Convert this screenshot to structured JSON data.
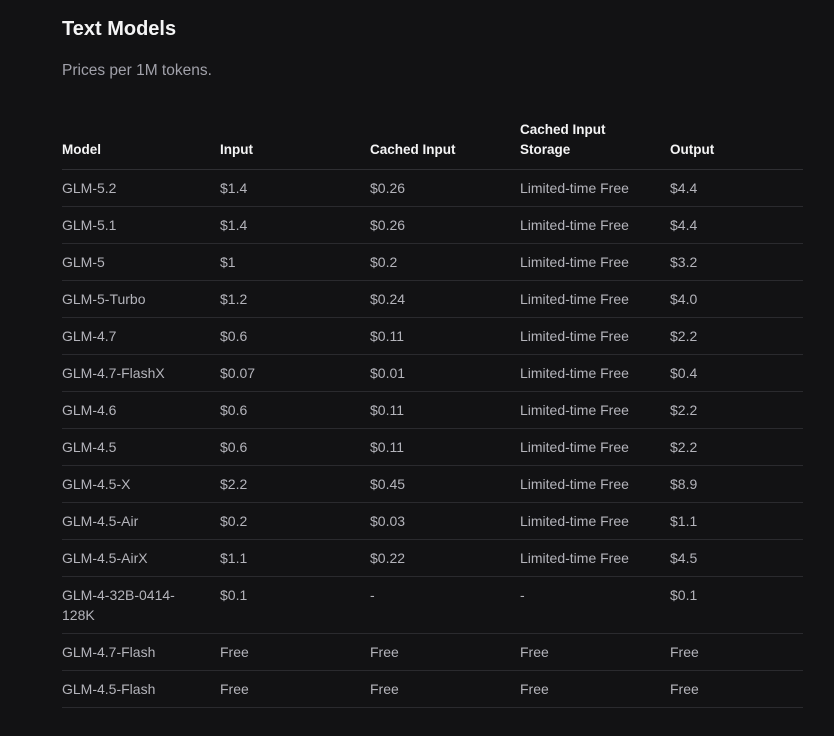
{
  "header": {
    "title": "Text Models",
    "subtitle": "Prices per 1M tokens."
  },
  "table": {
    "columns": [
      "Model",
      "Input",
      "Cached Input",
      "Cached Input\nStorage",
      "Output"
    ],
    "rows": [
      [
        "GLM-5.2",
        "$1.4",
        "$0.26",
        "Limited-time Free",
        "$4.4"
      ],
      [
        "GLM-5.1",
        "$1.4",
        "$0.26",
        "Limited-time Free",
        "$4.4"
      ],
      [
        "GLM-5",
        "$1",
        "$0.2",
        "Limited-time Free",
        "$3.2"
      ],
      [
        "GLM-5-Turbo",
        "$1.2",
        "$0.24",
        "Limited-time Free",
        "$4.0"
      ],
      [
        "GLM-4.7",
        "$0.6",
        "$0.11",
        "Limited-time Free",
        "$2.2"
      ],
      [
        "GLM-4.7-FlashX",
        "$0.07",
        "$0.01",
        "Limited-time Free",
        "$0.4"
      ],
      [
        "GLM-4.6",
        "$0.6",
        "$0.11",
        "Limited-time Free",
        "$2.2"
      ],
      [
        "GLM-4.5",
        "$0.6",
        "$0.11",
        "Limited-time Free",
        "$2.2"
      ],
      [
        "GLM-4.5-X",
        "$2.2",
        "$0.45",
        "Limited-time Free",
        "$8.9"
      ],
      [
        "GLM-4.5-Air",
        "$0.2",
        "$0.03",
        "Limited-time Free",
        "$1.1"
      ],
      [
        "GLM-4.5-AirX",
        "$1.1",
        "$0.22",
        "Limited-time Free",
        "$4.5"
      ],
      [
        "GLM-4-32B-0414-128K",
        "$0.1",
        "-",
        "-",
        "$0.1"
      ],
      [
        "GLM-4.7-Flash",
        "Free",
        "Free",
        "Free",
        "Free"
      ],
      [
        "GLM-4.5-Flash",
        "Free",
        "Free",
        "Free",
        "Free"
      ]
    ]
  }
}
